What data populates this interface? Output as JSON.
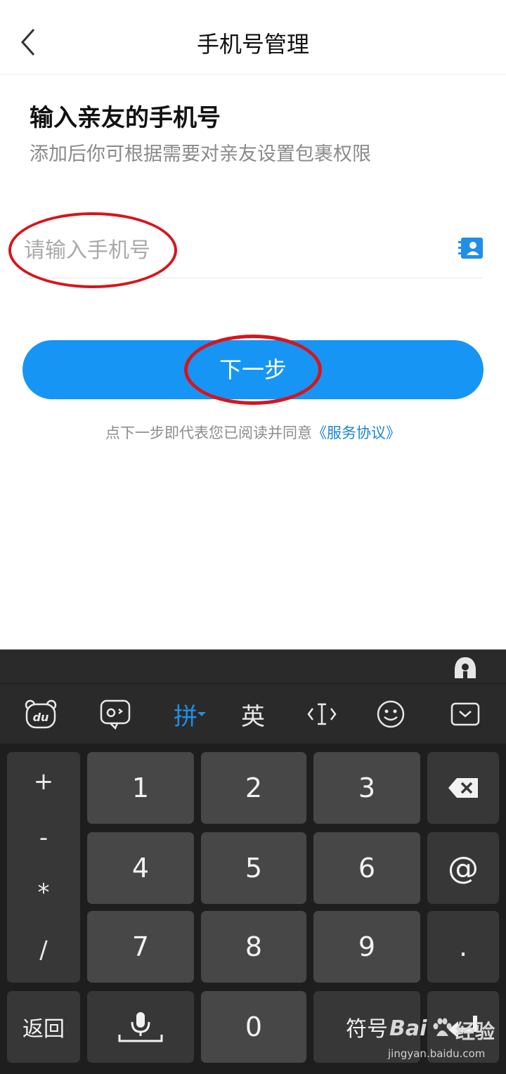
{
  "header": {
    "title": "手机号管理"
  },
  "form": {
    "heading": "输入亲友的手机号",
    "subheading": "添加后你可根据需要对亲友设置包裹权限",
    "phone_placeholder": "请输入手机号",
    "next_label": "下一步",
    "agreement_text": "点下一步即代表您已阅读并同意",
    "agreement_link": "《服务协议》"
  },
  "keyboard": {
    "toolbar": {
      "pinyin": "拼",
      "english": "英"
    },
    "symbols": [
      "+",
      "-",
      "*",
      "/"
    ],
    "digits": [
      "1",
      "2",
      "3",
      "4",
      "5",
      "6",
      "7",
      "8",
      "9",
      "0"
    ],
    "at": "@",
    "dot": ".",
    "back": "返回",
    "symbol_key": "符号"
  },
  "watermark": {
    "brand": "Bai",
    "brand2": "经验",
    "url": "jingyan.baidu.com"
  },
  "colors": {
    "primary": "#1695f5",
    "highlight_ring": "#d9141b",
    "link": "#1b84d8"
  }
}
